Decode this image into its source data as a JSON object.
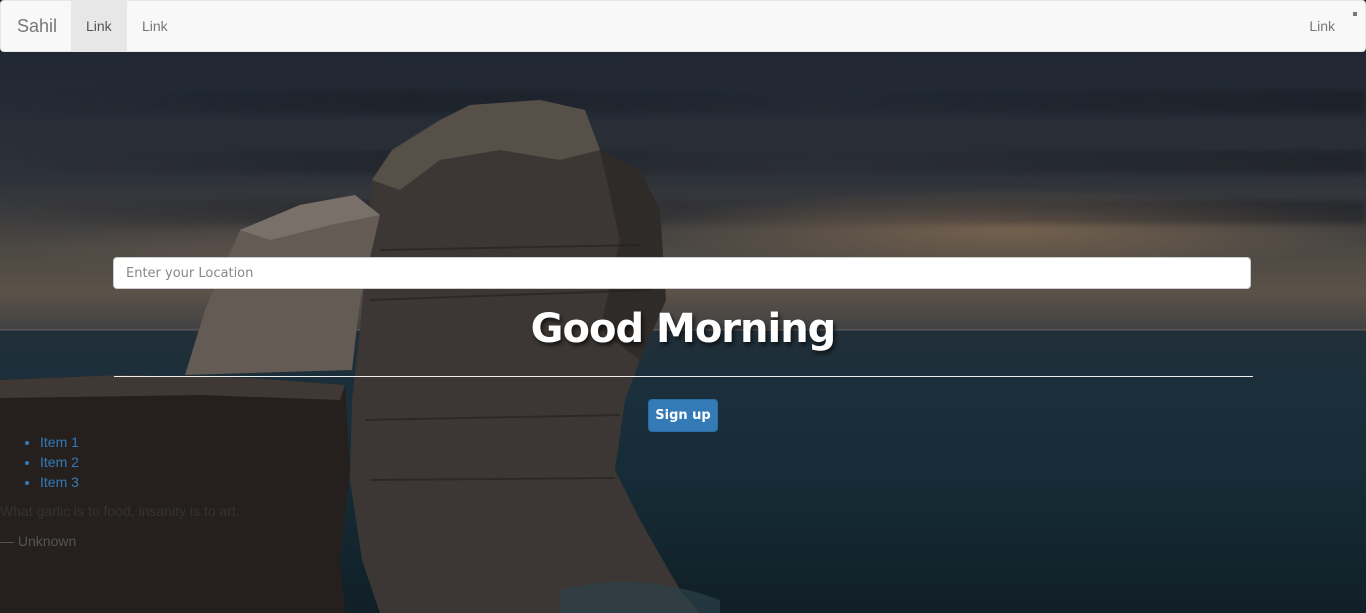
{
  "navbar": {
    "brand": "Sahil",
    "left_links": [
      "Link",
      "Link"
    ],
    "right_links": [
      "Link"
    ]
  },
  "search": {
    "placeholder": "Enter your Location",
    "value": ""
  },
  "main": {
    "greeting": "Good Morning",
    "signup_label": "Sign up"
  },
  "list": {
    "items": [
      "Item 1",
      "Item 2",
      "Item 3"
    ]
  },
  "quote": {
    "text": "What garlic is to food, insanity is to art.",
    "author": "— Unknown"
  },
  "colors": {
    "primary": "#337ab7",
    "navbar_bg": "#f8f8f8",
    "active_link_bg": "#e7e7e7",
    "greeting": "#ffffff"
  }
}
